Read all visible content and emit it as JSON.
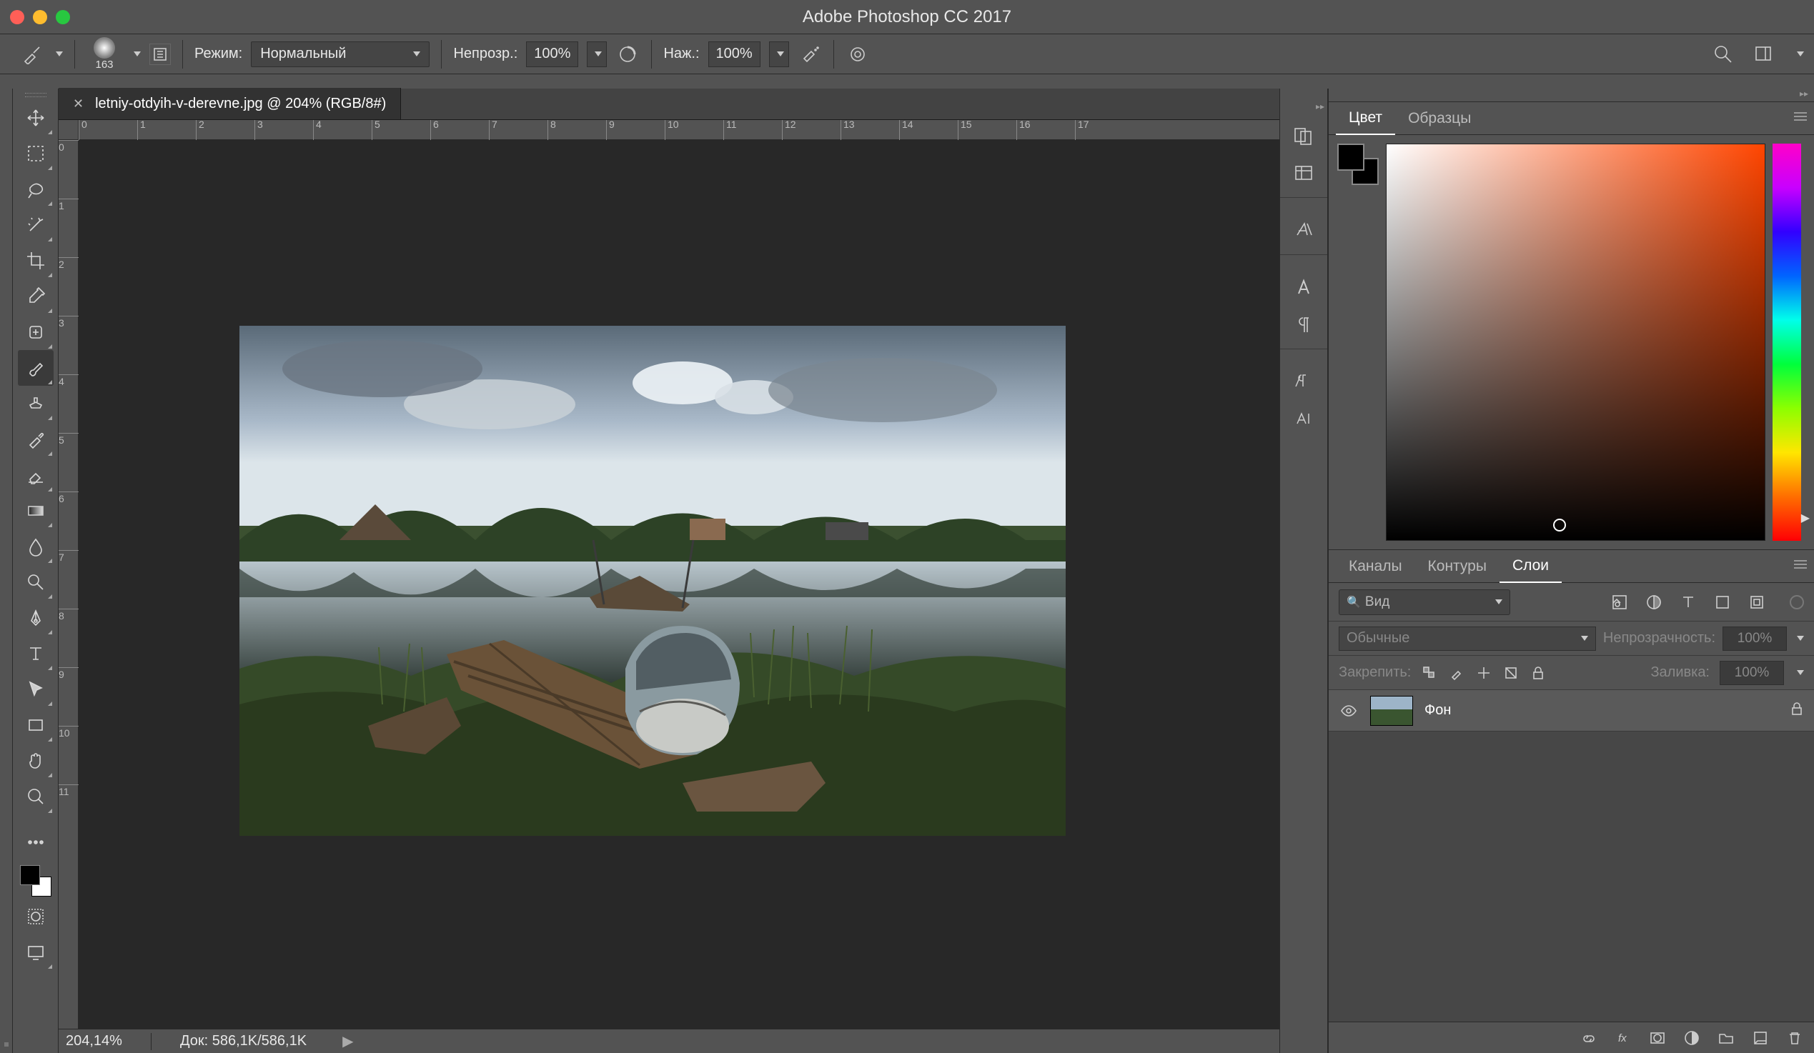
{
  "titlebar": {
    "title": "Adobe Photoshop CC 2017"
  },
  "optbar": {
    "brush_size": "163",
    "mode_label": "Режим:",
    "mode_value": "Нормальный",
    "opacity_label": "Непрозр.:",
    "opacity_value": "100%",
    "flow_label": "Наж.:",
    "flow_value": "100%"
  },
  "document": {
    "tab_title": "letniy-otdyih-v-derevne.jpg @ 204% (RGB/8#)",
    "zoom": "204,14%",
    "doc_label": "Док:",
    "doc_size": "586,1K/586,1K"
  },
  "ruler_h": [
    "0",
    "1",
    "2",
    "3",
    "4",
    "5",
    "6",
    "7",
    "8",
    "9",
    "10",
    "11",
    "12",
    "13",
    "14",
    "15",
    "16",
    "17"
  ],
  "ruler_v": [
    "0",
    "1",
    "2",
    "3",
    "4",
    "5",
    "6",
    "7",
    "8",
    "9",
    "10",
    "11"
  ],
  "panels": {
    "color_tab": "Цвет",
    "swatches_tab": "Образцы",
    "channels_tab": "Каналы",
    "paths_tab": "Контуры",
    "layers_tab": "Слои"
  },
  "layers": {
    "kind_placeholder": "Вид",
    "blend_mode": "Обычные",
    "opacity_label": "Непрозрачность:",
    "opacity_value": "100%",
    "lock_label": "Закрепить:",
    "fill_label": "Заливка:",
    "fill_value": "100%",
    "items": [
      {
        "name": "Фон",
        "locked": true
      }
    ]
  }
}
